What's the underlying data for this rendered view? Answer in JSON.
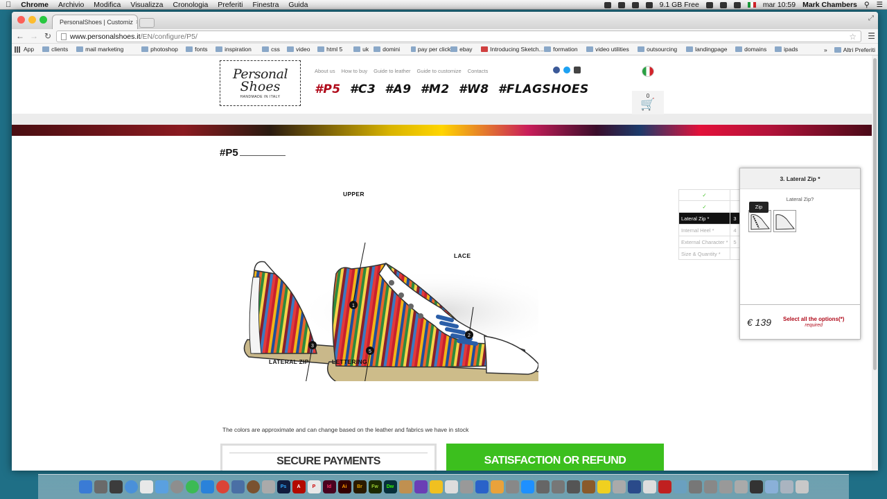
{
  "menubar": {
    "app": "Chrome",
    "menus": [
      "Archivio",
      "Modifica",
      "Visualizza",
      "Cronologia",
      "Preferiti",
      "Finestra",
      "Guida"
    ],
    "disk": "9.1 GB Free",
    "clock": "mar 10:59",
    "user": "Mark Chambers"
  },
  "browser": {
    "tab_title": "PersonalShoes | Customiz",
    "url_host": "www.personalshoes.it",
    "url_path": "/EN/configure/P5/",
    "bookmarks": [
      "clients",
      "mail marketing",
      "photoshop",
      "fonts",
      "inspiration",
      "css",
      "video",
      "html 5",
      "uk",
      "domini",
      "pay per click",
      "ebay",
      "Introducing Sketch...",
      "formation",
      "video utilities",
      "outsourcing",
      "landingpage",
      "domains",
      "ipads"
    ],
    "bookmarks_apps": "App",
    "bookmarks_more": "»",
    "bookmarks_other": "Altri Preferiti"
  },
  "site": {
    "logo_line1": "Personal",
    "logo_line2": "Shoes",
    "logo_tagline": "HANDMADE IN ITALY",
    "nav": [
      "About us",
      "How to buy",
      "Guide to leather",
      "Guide to customize",
      "Contacts"
    ],
    "models": [
      "#P5",
      "#C3",
      "#A9",
      "#M2",
      "#W8",
      "#FLAGSHOES"
    ],
    "cart_count": "0"
  },
  "product": {
    "title": "#P5",
    "labels": {
      "upper": "UPPER",
      "lace": "LACE",
      "lateral_zip": "LATERAL ZIP",
      "lettering": "LETTERING"
    },
    "markers": [
      "1",
      "2",
      "3",
      "5"
    ],
    "disclaimer": "The colors are approximate and can change based on the leather and fabrics we have in stock",
    "secure": "SECURE PAYMENTS",
    "refund": "SATISFACTION OR REFUND"
  },
  "steps": [
    {
      "label": "",
      "num": "",
      "done": "✓"
    },
    {
      "label": "",
      "num": "",
      "done": "✓"
    },
    {
      "label": "Lateral Zip *",
      "num": "3"
    },
    {
      "label": "Internal Heel *",
      "num": "4"
    },
    {
      "label": "External Character *",
      "num": "5"
    },
    {
      "label": "Size & Quantity *",
      "num": ""
    }
  ],
  "panel": {
    "title": "3. Lateral Zip *",
    "question": "Lateral Zip?",
    "tooltip": "Zip",
    "price": "€ 139",
    "select_msg": "Select all the options(*)",
    "required": "required"
  },
  "colors": {
    "accent_red": "#b00a1a",
    "refund_green": "#3cbf1e",
    "check_green": "#3cbf1e"
  }
}
